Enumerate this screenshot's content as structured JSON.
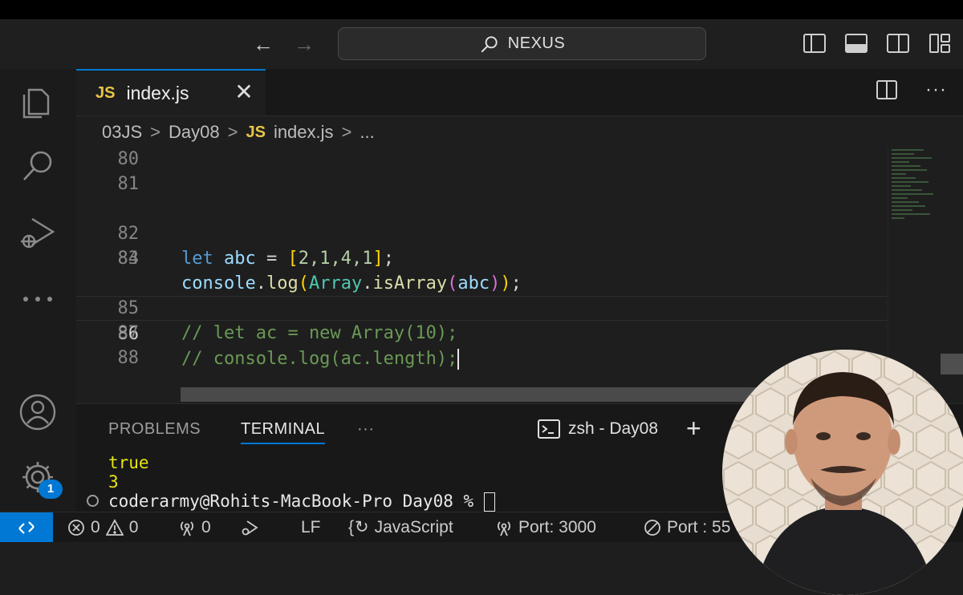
{
  "title_bar": {
    "search_label": "NEXUS",
    "back_icon": "arrow-left-icon",
    "forward_icon": "arrow-right-icon",
    "layout_icons": [
      "toggle-primary-sidebar-icon",
      "toggle-panel-icon",
      "toggle-secondary-sidebar-icon",
      "customize-layout-icon"
    ]
  },
  "activity_bar": {
    "items": [
      "explorer-icon",
      "search-icon",
      "run-debug-icon",
      "more-icon",
      "account-icon",
      "manage-gear-icon"
    ],
    "manage_badge": "1"
  },
  "tab": {
    "badge": "JS",
    "filename": "index.js",
    "close": "✕"
  },
  "breadcrumb": {
    "parts": [
      "03JS",
      "Day08",
      "index.js",
      "..."
    ],
    "file_badge": "JS",
    "separator": ">"
  },
  "editor": {
    "line_numbers": [
      "80",
      "81",
      "82",
      "83",
      "84",
      "85",
      "86",
      "87",
      "88"
    ],
    "active_line": "86",
    "code": {
      "l82": {
        "kw": "let",
        "var": "abc",
        "eq": " = ",
        "open": "[",
        "vals": "2,1,4,1",
        "close": "]",
        "end": ";"
      },
      "l83": {
        "obj": "console",
        "dot": ".",
        "fn": "log",
        "open1": "(",
        "cls": "Array",
        "dot2": ".",
        "fn2": "isArray",
        "open2": "(",
        "arg": "abc",
        "close2": ")",
        "close1": ")",
        "end": ";"
      },
      "l85": "// let ac = new Array(10);",
      "l86": "// console.log(ac.length);"
    }
  },
  "panel": {
    "tabs": [
      "PROBLEMS",
      "TERMINAL",
      "···"
    ],
    "active_tab": "TERMINAL",
    "terminal_profile": "zsh - Day08",
    "add_terminal": "+",
    "output": [
      "true",
      "3"
    ],
    "prompt": "coderarmy@Rohits-MacBook-Pro Day08 % "
  },
  "status_bar": {
    "errors": "0",
    "warnings": "0",
    "ports_forwarded": "0",
    "eol": "LF",
    "language": "JavaScript",
    "port1": "Port: 3000",
    "port2": "Port : 55",
    "accent": "#0078d4"
  },
  "colors": {
    "keyword": "#569cd6",
    "variable": "#9cdcfe",
    "number": "#b5cea8",
    "comment": "#6a9955",
    "function": "#dcdcaa",
    "class": "#4ec9b0"
  }
}
